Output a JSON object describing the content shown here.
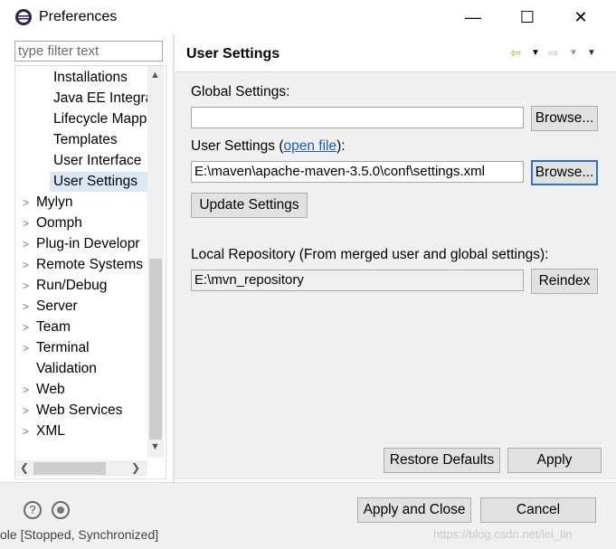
{
  "window": {
    "title": "Preferences",
    "min_label": "—",
    "max_label": "☐",
    "close_label": "✕"
  },
  "filter": {
    "placeholder": "type filter text"
  },
  "tree": {
    "items": [
      {
        "label": "Installations",
        "chevron": ""
      },
      {
        "label": "Java EE Integra",
        "chevron": ""
      },
      {
        "label": "Lifecycle Mapp",
        "chevron": ""
      },
      {
        "label": "Templates",
        "chevron": ""
      },
      {
        "label": "User Interface",
        "chevron": ""
      },
      {
        "label": "User Settings",
        "chevron": "",
        "selected": true
      },
      {
        "label": "Mylyn",
        "chevron": ">"
      },
      {
        "label": "Oomph",
        "chevron": ">"
      },
      {
        "label": "Plug-in Developr",
        "chevron": ">"
      },
      {
        "label": "Remote Systems",
        "chevron": ">"
      },
      {
        "label": "Run/Debug",
        "chevron": ">"
      },
      {
        "label": "Server",
        "chevron": ">"
      },
      {
        "label": "Team",
        "chevron": ">"
      },
      {
        "label": "Terminal",
        "chevron": ">"
      },
      {
        "label": "Validation",
        "chevron": ""
      },
      {
        "label": "Web",
        "chevron": ">"
      },
      {
        "label": "Web Services",
        "chevron": ">"
      },
      {
        "label": "XML",
        "chevron": ">"
      }
    ]
  },
  "page": {
    "title": "User Settings",
    "global_label": "Global Settings:",
    "global_value": "",
    "browse1": "Browse...",
    "user_label_prefix": "User Settings (",
    "user_label_link": "open file",
    "user_label_suffix": "):",
    "user_value": "E:\\maven\\apache-maven-3.5.0\\conf\\settings.xml",
    "browse2": "Browse...",
    "update": "Update Settings",
    "local_label": "Local Repository (From merged user and global settings):",
    "local_value": "E:\\mvn_repository",
    "reindex": "Reindex",
    "restore": "Restore Defaults",
    "apply": "Apply"
  },
  "footer": {
    "help_icon_glyph": "?",
    "apply_close": "Apply and Close",
    "cancel": "Cancel",
    "watermark": "https://blog.csdn.net/lei_lin",
    "background_text": "ole [Stopped, Synchronized]"
  },
  "colors": {
    "selection": "#d9e7f7",
    "focus": "#2a73d6",
    "link": "#1a5fb4"
  }
}
